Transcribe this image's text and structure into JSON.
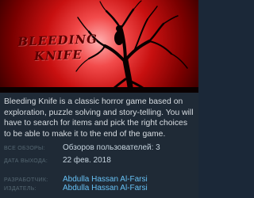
{
  "hero": {
    "title_line1": "BLEEDING",
    "title_line2": "KNIFE"
  },
  "description": "Bleeding Knife is a classic horror game based on exploration, puzzle solving and story-telling. You will have to search for items and pick the right choices to be able to make it to the end of the game.",
  "details": {
    "reviews_label": "ВСЕ ОБЗОРЫ:",
    "reviews_value": "Обзоров пользователей: 3",
    "release_label": "ДАТА ВЫХОДА:",
    "release_value": "22 фев. 2018",
    "developer_label": "РАЗРАБОТЧИК:",
    "developer_value": "Abdulla Hassan Al-Farsi",
    "publisher_label": "ИЗДАТЕЛЬ:",
    "publisher_value": "Abdulla Hassan Al-Farsi"
  },
  "colors": {
    "background": "#1f2a36",
    "label": "#556772",
    "text": "#c6d4df",
    "link": "#66c0f4",
    "moon_red": "#c81010"
  }
}
